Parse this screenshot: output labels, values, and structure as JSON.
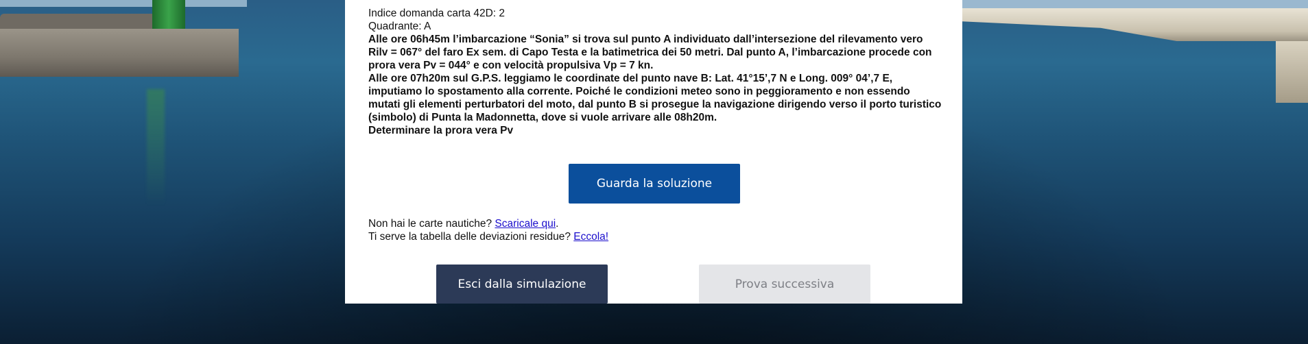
{
  "question": {
    "index_label": "Indice domanda carta 42D: 2",
    "quadrant_label": "Quadrante: A",
    "paragraph_1": "Alle ore 06h45m l’imbarcazione “Sonia” si trova sul punto A individuato dall’intersezione del rilevamento vero Rilv = 067° del faro Ex sem. di Capo Testa e la batimetrica dei 50 metri. Dal punto A, l’imbarcazione procede con prora vera Pv = 044° e con velocità propulsiva Vp = 7 kn.",
    "paragraph_2": "Alle ore 07h20m sul G.P.S. leggiamo le coordinate del punto nave B: Lat. 41°15’,7 N e Long. 009° 04’,7 E, imputiamo lo spostamento alla corrente. Poiché le condizioni meteo sono in peggioramento e non essendo mutati gli elementi perturbatori del moto, dal punto B si prosegue la navigazione dirigendo verso il porto turistico (simbolo) di Punta la Madonnetta, dove si vuole arrivare alle 08h20m.",
    "paragraph_3": "Determinare la prora vera Pv"
  },
  "actions": {
    "solution_label": "Guarda la soluzione",
    "exit_label": "Esci dalla simulazione",
    "next_label": "Prova successiva"
  },
  "help": {
    "charts_prefix": "Non hai le carte nautiche? ",
    "charts_link": "Scaricale qui",
    "charts_suffix": ".",
    "deviation_prefix": "Ti serve la tabella delle deviazioni residue? ",
    "deviation_link": "Eccola!"
  },
  "colors": {
    "primary_button": "#0b4f9c",
    "exit_button": "#2c3a57",
    "disabled_button": "#e4e5e8",
    "link": "#1a0dcc"
  }
}
